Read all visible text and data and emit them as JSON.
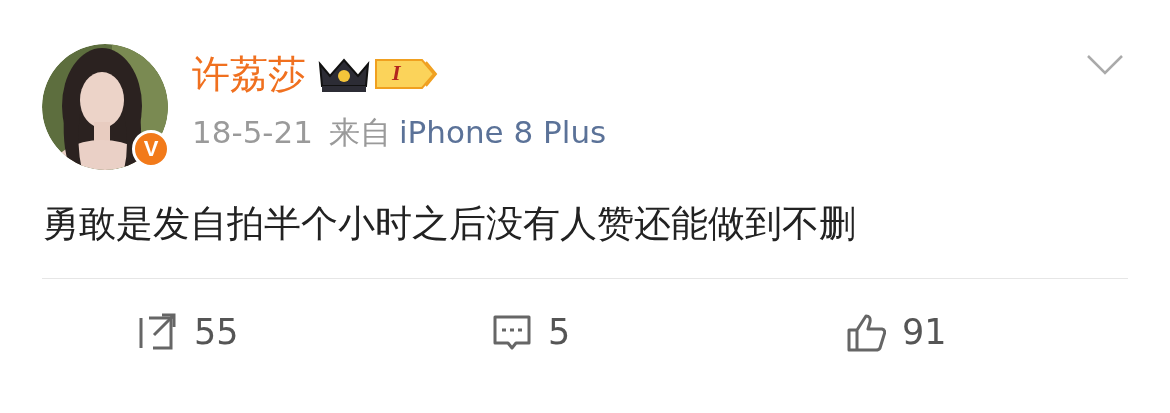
{
  "post": {
    "author": {
      "name": "许荔莎",
      "level_badge": "I",
      "verified_badge": "V"
    },
    "date": "18-5-21",
    "source_prefix": "来自",
    "source": "iPhone 8 Plus",
    "text": "勇敢是发自拍半个小时之后没有人赞还能做到不删"
  },
  "actions": [
    {
      "kind": "repost",
      "count": "55"
    },
    {
      "kind": "comment",
      "count": "5"
    },
    {
      "kind": "like",
      "count": "91"
    }
  ]
}
